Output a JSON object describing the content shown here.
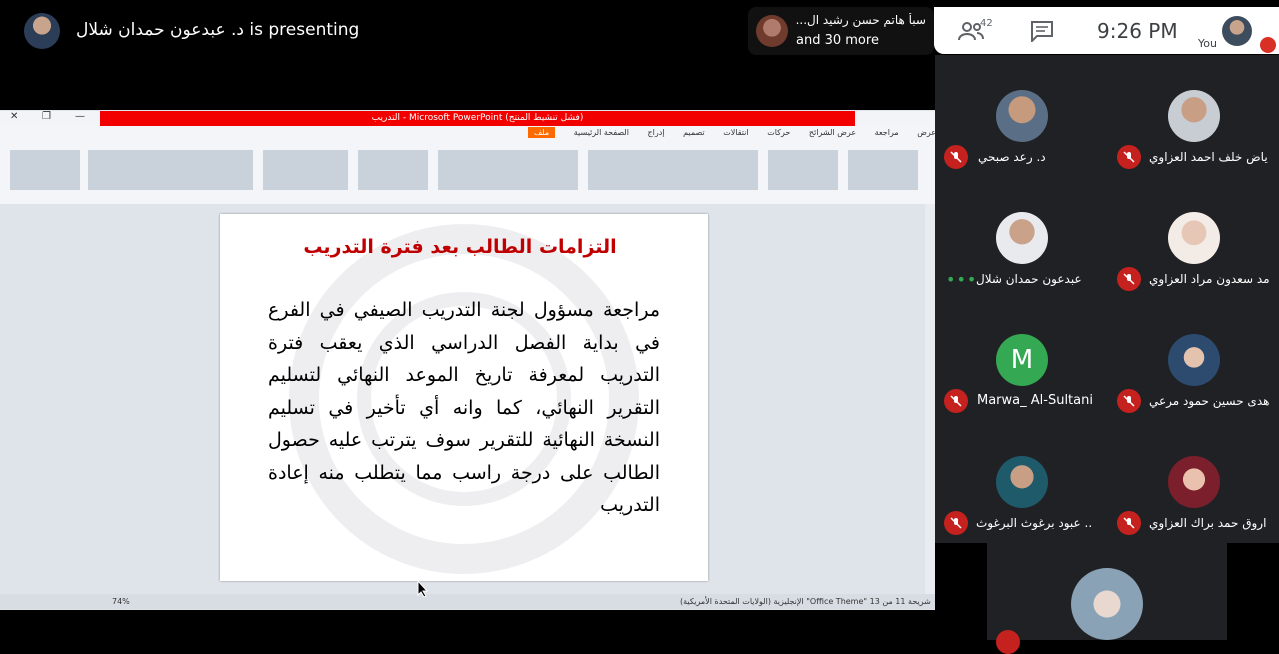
{
  "presenter": {
    "text": "د. عبدعون حمدان شلال is presenting"
  },
  "participants_popup": {
    "line1": "سبأ هاتم حسن رشيد ال...",
    "line2": "and 30 more"
  },
  "topbar": {
    "people_count": "42",
    "time": "9:26 PM",
    "you_label": "You"
  },
  "tiles": [
    {
      "name": "ياض خلف احمد العزاوي",
      "muted": true
    },
    {
      "name": "د. رعد صبحي",
      "muted": true
    },
    {
      "name": "مد سعدون مراد العزاوي",
      "muted": true
    },
    {
      "name": "د. عبدعون حمدان شلال",
      "muted": false,
      "speaking": "•••"
    },
    {
      "name": "هدى حسين حمود مرعي",
      "muted": true
    },
    {
      "name": "Marwa_ Al-Sultani",
      "muted": true,
      "initial": "M"
    },
    {
      "name": "اروق حمد براك العزاوي",
      "muted": true
    },
    {
      "name": "عبود برغوث البرغوث ...",
      "muted": true
    }
  ],
  "ppt": {
    "title": "التدريب - Microsoft PowerPoint (فشل تنشيط المنتج)",
    "tabs": [
      "ملف",
      "الصفحة الرئيسية",
      "إدراج",
      "تصميم",
      "انتقالات",
      "حركات",
      "عرض الشرائح",
      "مراجعة",
      "عرض"
    ],
    "zoom": "74%",
    "status": "شريحة 11 من 13   \"Office Theme\"   الإنجليزية (الولايات المتحدة الأمريكية)"
  },
  "slide": {
    "title": "التزامات الطالب بعد فترة التدريب",
    "body": "مراجعة مسؤول لجنة التدريب الصيفي في الفرع في بداية الفصل الدراسي الذي يعقب فترة التدريب لمعرفة تاريخ الموعد النهائي لتسليم التقرير النهائي، كما وانه أي تأخير في تسليم النسخة النهائية للتقرير سوف يترتب عليه حصول الطالب على درجة راسب مما يتطلب منه إعادة التدريب"
  },
  "colors": {
    "mic_off": "#c5221f",
    "title_bar": "#f20000",
    "slide_title": "#c00000",
    "tile_bg": "#202124"
  }
}
